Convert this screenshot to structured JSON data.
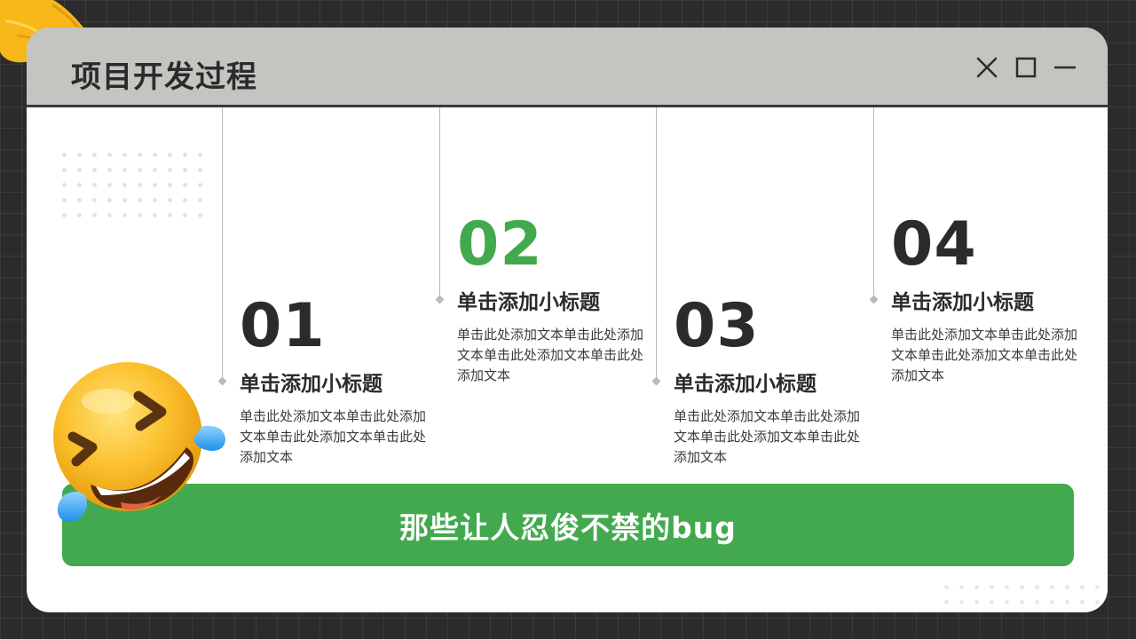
{
  "window": {
    "title": "项目开发过程",
    "controls": [
      "close-icon",
      "maximize-icon",
      "minimize-icon"
    ]
  },
  "steps": [
    {
      "number": "01",
      "title": "单击添加小标题",
      "text": "单击此处添加文本单击此处添加文本单击此处添加文本单击此处添加文本",
      "highlight": false
    },
    {
      "number": "02",
      "title": "单击添加小标题",
      "text": "单击此处添加文本单击此处添加文本单击此处添加文本单击此处添加文本",
      "highlight": true
    },
    {
      "number": "03",
      "title": "单击添加小标题",
      "text": "单击此处添加文本单击此处添加文本单击此处添加文本单击此处添加文本",
      "highlight": false
    },
    {
      "number": "04",
      "title": "单击添加小标题",
      "text": "单击此处添加文本单击此处添加文本单击此处添加文本单击此处添加文本",
      "highlight": false
    }
  ],
  "banner": {
    "text": "那些让人忍俊不禁的bug"
  },
  "decorations": {
    "emoji": "laughing-emoji-icon",
    "hand": "pointing-hand-icon"
  },
  "colors": {
    "accent": "#43a94e",
    "titlebar": "#c4c4c1",
    "background": "#2b2b2b",
    "text": "#2b2b2b"
  }
}
